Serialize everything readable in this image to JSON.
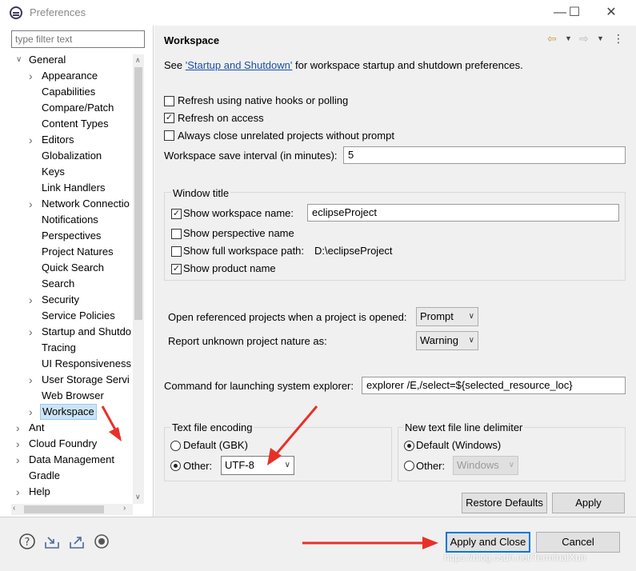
{
  "window": {
    "title": "Preferences",
    "minimize": "—",
    "maximize": "☐",
    "close": "✕"
  },
  "filter": {
    "placeholder": "type filter text"
  },
  "tree": {
    "general": "General",
    "children": [
      "Appearance",
      "Capabilities",
      "Compare/Patch",
      "Content Types",
      "Editors",
      "Globalization",
      "Keys",
      "Link Handlers",
      "Network Connectio",
      "Notifications",
      "Perspectives",
      "Project Natures",
      "Quick Search",
      "Search",
      "Security",
      "Service Policies",
      "Startup and Shutdo",
      "Tracing",
      "UI Responsiveness",
      "User Storage Servi",
      "Web Browser",
      "Workspace"
    ],
    "top_level": [
      "Ant",
      "Cloud Foundry",
      "Data Management",
      "Gradle",
      "Help"
    ]
  },
  "page": {
    "title": "Workspace",
    "see_prefix": "See ",
    "see_link": "'Startup and Shutdown'",
    "see_suffix": " for workspace startup and shutdown preferences.",
    "refresh_native": "Refresh using native hooks or polling",
    "refresh_access": "Refresh on access",
    "always_close": "Always close unrelated projects without prompt",
    "save_interval_label": "Workspace save interval (in minutes):",
    "save_interval_value": "5",
    "window_title_group": "Window title",
    "show_ws_name": "Show workspace name:",
    "ws_name_value": "eclipseProject",
    "show_perspective": "Show perspective name",
    "show_full_path": "Show full workspace path:",
    "full_path_value": "D:\\eclipseProject",
    "show_product": "Show product name",
    "open_ref_label": "Open referenced projects when a project is opened:",
    "open_ref_value": "Prompt",
    "report_unknown_label": "Report unknown project nature as:",
    "report_unknown_value": "Warning",
    "cmd_label": "Command for launching system explorer:",
    "cmd_value": "explorer /E,/select=${selected_resource_loc}",
    "encoding_group": "Text file encoding",
    "default_enc": "Default (GBK)",
    "other_enc": "Other:",
    "other_enc_value": "UTF-8",
    "delim_group": "New text file line delimiter",
    "default_delim": "Default (Windows)",
    "other_delim": "Other:",
    "other_delim_value": "Windows",
    "restore_defaults": "Restore Defaults",
    "apply": "Apply"
  },
  "bottom": {
    "apply_close": "Apply and Close",
    "cancel": "Cancel",
    "watermark": "https://blog.csdn.net/TerminalXun"
  },
  "icons": [
    "help-icon",
    "import-icon",
    "export-icon",
    "record-icon",
    "back-icon",
    "forward-icon",
    "menu-icon"
  ],
  "colors": {
    "accent": "#0078d7",
    "link": "#1a4ea8",
    "annotation": "#e8302a"
  }
}
